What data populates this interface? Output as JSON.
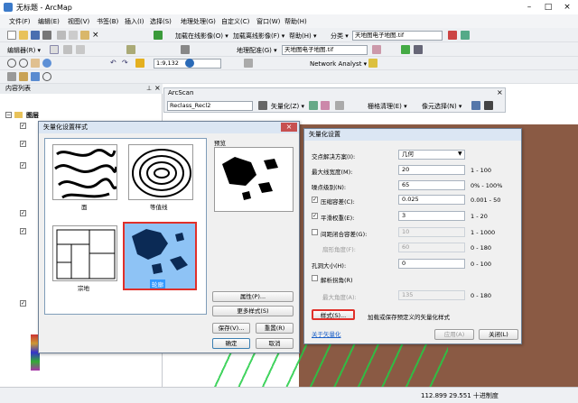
{
  "app": {
    "title": "无标题 - ArcMap"
  },
  "window_buttons": {
    "minimize": "–",
    "maximize": "□",
    "close": "×"
  },
  "menus": [
    "文件(F)",
    "编辑(E)",
    "视图(V)",
    "书签(B)",
    "插入(I)",
    "选择(S)",
    "地理处理(G)",
    "自定义(C)",
    "窗口(W)",
    "帮助(H)"
  ],
  "toolbar1": {
    "load_online": "加载在线影像(O) ▾",
    "load_offline": "加载离线影像(F) ▾",
    "help": "帮助(H) ▾",
    "classify": "分类 ▾",
    "layer_combo": "天地图电子地图.tif"
  },
  "toolbar2": {
    "editor": "编辑器(R) ▾",
    "georef": "地理配准(G) ▾",
    "georef_layer": "天地图电子地图.tif"
  },
  "toolbar3": {
    "scale": "1:9,132",
    "network_analyst": "Network Analyst ▾"
  },
  "toc": {
    "title": "内容列表",
    "layers_root": "图层"
  },
  "arcscan": {
    "title": "ArcScan",
    "layer": "Reclass_Recl2",
    "vectorize": "矢量化(Z) ▾",
    "raster_cleanup": "栅格清理(E) ▾",
    "cell_select": "像元选择(N) ▾"
  },
  "style_dialog": {
    "title": "矢量化设置样式",
    "close_label": "×",
    "preview_label": "预览",
    "styles": [
      {
        "label": "面"
      },
      {
        "label": "等值线"
      },
      {
        "label": "宗地"
      },
      {
        "label": "轮廓"
      }
    ],
    "properties_button": "属性(P)...",
    "more_styles_button": "更多样式(S)",
    "save_button": "保存(V)...",
    "reset_button": "重置(R)",
    "ok_button": "确定",
    "cancel_button": "取消"
  },
  "settings_dialog": {
    "title": "矢量化设置",
    "intersection_solution": {
      "label": "交点解决方案(I):",
      "value": "几何"
    },
    "max_line_width": {
      "label": "最大线宽度(M):",
      "value": "20",
      "range": "1 - 100"
    },
    "noise_level": {
      "label": "噪点级别(N):",
      "value": "65",
      "range": "0% - 100%"
    },
    "compression_tolerance": {
      "label": "压缩容差(C):",
      "value": "0.025",
      "range": "0.001 - 50",
      "checked": true
    },
    "smoothing_weight": {
      "label": "平滑权重(E):",
      "value": "3",
      "range": "1 - 20",
      "checked": true
    },
    "gap_closure_tolerance": {
      "label": "间距闭合容差(G):",
      "value": "10",
      "range": "1 - 1000",
      "checked": false
    },
    "fan_angle": {
      "label": "扇形角度(F):",
      "value": "60",
      "range": "0 - 180"
    },
    "hole_size": {
      "label": "孔洞大小(H):",
      "value": "0",
      "range": "0 - 100"
    },
    "resolve_corners": {
      "label": "解析拐角(R)",
      "checked": false
    },
    "max_angle": {
      "label": "最大角度(A):",
      "value": "135",
      "range": "0 - 180"
    },
    "styles_button": "样式(S)...",
    "styles_description": "加载或保存预定义的矢量化样式",
    "about_link": "关于矢量化",
    "apply_button": "应用(A)",
    "close_button": "关闭(L)"
  },
  "statusbar": {
    "coords": "112.899  29.551 十进制度"
  },
  "colors": {
    "accent": "#3399ff",
    "selection_border": "#e0302a",
    "map_brown": "#8a5a44",
    "map_green": "#22cc44"
  }
}
